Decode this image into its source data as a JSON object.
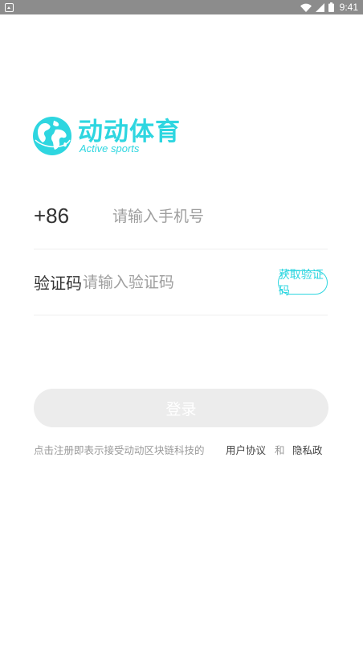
{
  "status_bar": {
    "time": "9:41",
    "icons": [
      "notification-icon",
      "wifi-icon",
      "cellular-icon",
      "battery-icon"
    ]
  },
  "logo": {
    "name_cn": "动动体育",
    "name_en": "Active sports",
    "icon": "globe-icon"
  },
  "form": {
    "phone_prefix": "+86",
    "phone_placeholder": "请输入手机号",
    "code_label": "验证码",
    "code_placeholder": "请输入验证码",
    "get_code_label": "获取验证码"
  },
  "login_label": "登录",
  "agreement": {
    "prefix": "点击注册即表示接受动动区块链科技的",
    "user_agreement": "用户协议",
    "and": "和",
    "privacy_policy": "隐私政策"
  },
  "colors": {
    "accent": "#2ed6e0",
    "button_disabled": "#ececec",
    "status_bar": "#8c8c8c"
  }
}
